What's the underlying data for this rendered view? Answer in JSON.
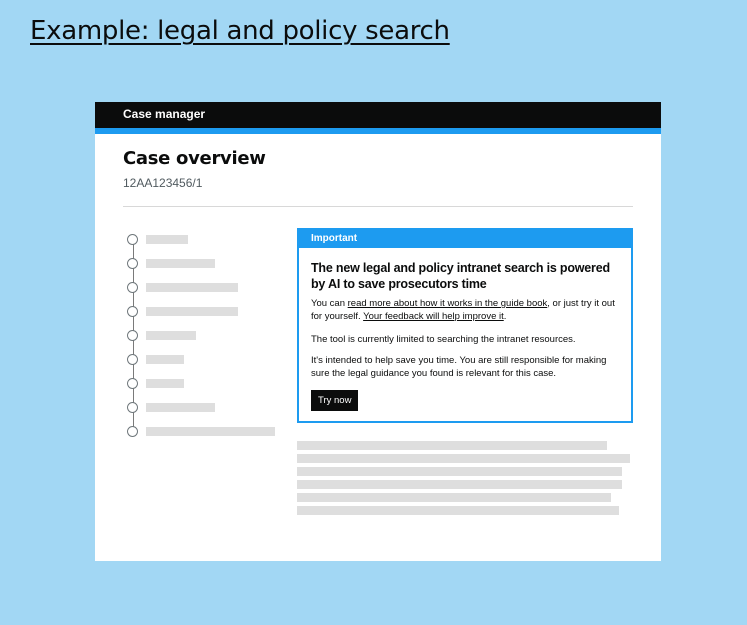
{
  "slide": {
    "title": "Example: legal and policy search"
  },
  "app": {
    "header": {
      "name": "Case manager"
    },
    "page": {
      "title": "Case overview",
      "case_reference": "12AA123456/1"
    },
    "notification": {
      "label": "Important",
      "heading": "The new legal and policy intranet search is powered by AI to save prosecutors time",
      "paragraph1": {
        "prefix": "You can ",
        "link1": "read more about how it works in the guide book",
        "middle": ", or just try it out for yourself. ",
        "link2": "Your feedback will help improve it",
        "suffix": "."
      },
      "paragraph2": "The tool is currently limited to searching the intranet resources.",
      "paragraph3": "It's intended to help save you time. You are still responsible for making sure the legal guidance you found is relevant for this case.",
      "button_label": "Try now"
    }
  },
  "colors": {
    "background": "#a2d7f4",
    "header": "#0b0c0c",
    "accent": "#1d9bf0",
    "placeholder": "#dedede"
  }
}
